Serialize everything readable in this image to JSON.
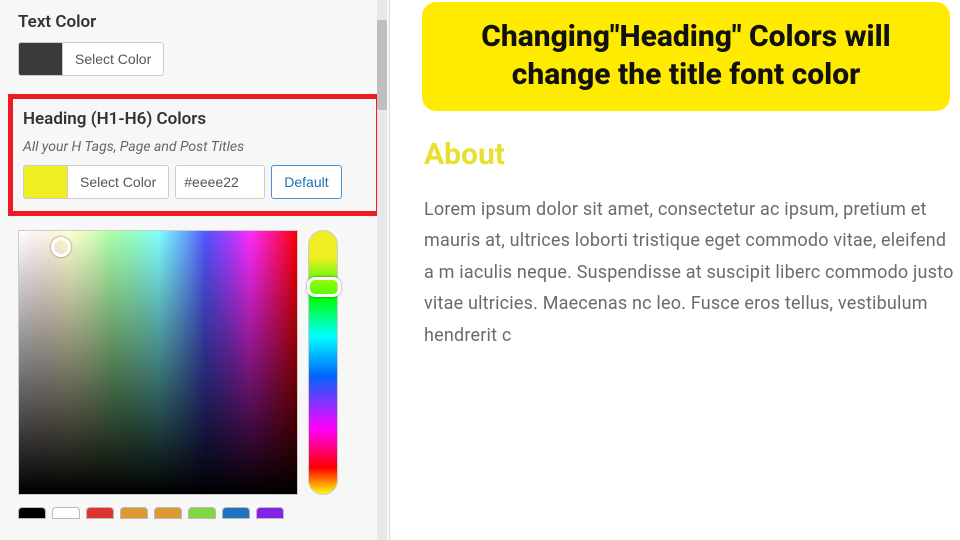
{
  "panel": {
    "textColor": {
      "title": "Text Color",
      "selectLabel": "Select Color",
      "swatch": "#3a3a3a"
    },
    "headingColor": {
      "title": "Heading (H1-H6) Colors",
      "subtitle": "All your H Tags, Page and Post Titles",
      "selectLabel": "Select Color",
      "hexValue": "#eeee22",
      "defaultLabel": "Default",
      "swatch": "#eeee22"
    },
    "palette": [
      "#000000",
      "#ffffff",
      "#d33",
      "#d93",
      "#dd9933",
      "#81d742",
      "#1e73be",
      "#8224e3"
    ]
  },
  "callout": {
    "text": "Changing\"Heading\" Colors will change the title font color"
  },
  "preview": {
    "aboutTitle": "About",
    "bodyText": "Lorem ipsum dolor sit amet, consectetur ac ipsum, pretium et mauris at, ultrices loborti tristique eget commodo vitae, eleifend a m iaculis neque. Suspendisse at suscipit liberc commodo justo vitae ultricies. Maecenas nc leo. Fusce eros tellus, vestibulum hendrerit c"
  }
}
